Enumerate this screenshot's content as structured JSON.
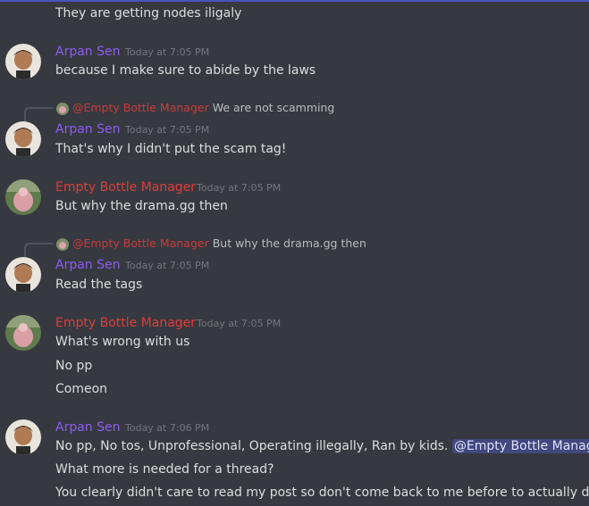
{
  "colors": {
    "background": "#36393f",
    "arpan_name": "#8b5cf6",
    "empty_name": "#e03c3c",
    "timestamp": "#72767d",
    "mention_bg": "#5865f2"
  },
  "top_message": {
    "text": "They are getting nodes iligaly"
  },
  "messages": [
    {
      "author": "Arpan Sen",
      "timestamp": "Today at 7:05 PM",
      "lines": [
        "because I make sure to abide by the laws"
      ]
    },
    {
      "reply": {
        "author": "@Empty Bottle Manager",
        "text": "We are not scamming"
      },
      "author": "Arpan Sen",
      "timestamp": "Today at 7:05 PM",
      "lines": [
        "That's why I didn't put the scam tag!"
      ]
    },
    {
      "author": "Empty Bottle Manager",
      "timestamp": "Today at 7:05 PM",
      "lines": [
        "But why the drama.gg then"
      ]
    },
    {
      "reply": {
        "author": "@Empty Bottle Manager",
        "text": "But why the drama.gg then"
      },
      "author": "Arpan Sen",
      "timestamp": "Today at 7:05 PM",
      "lines": [
        "Read the tags"
      ]
    },
    {
      "author": "Empty Bottle Manager",
      "timestamp": "Today at 7:05 PM",
      "lines": [
        "What's wrong with us",
        "No pp",
        "Comeon"
      ]
    },
    {
      "author": "Arpan Sen",
      "timestamp": "Today at 7:06 PM",
      "lines": [
        "No pp, No tos, Unprofessional, Operating illegally, Ran by kids.",
        "What more is needed for a thread?",
        "You clearly didn't care to read my post so don't come back to me before to actually do."
      ],
      "mention": "@Empty Bottle Manager"
    }
  ]
}
